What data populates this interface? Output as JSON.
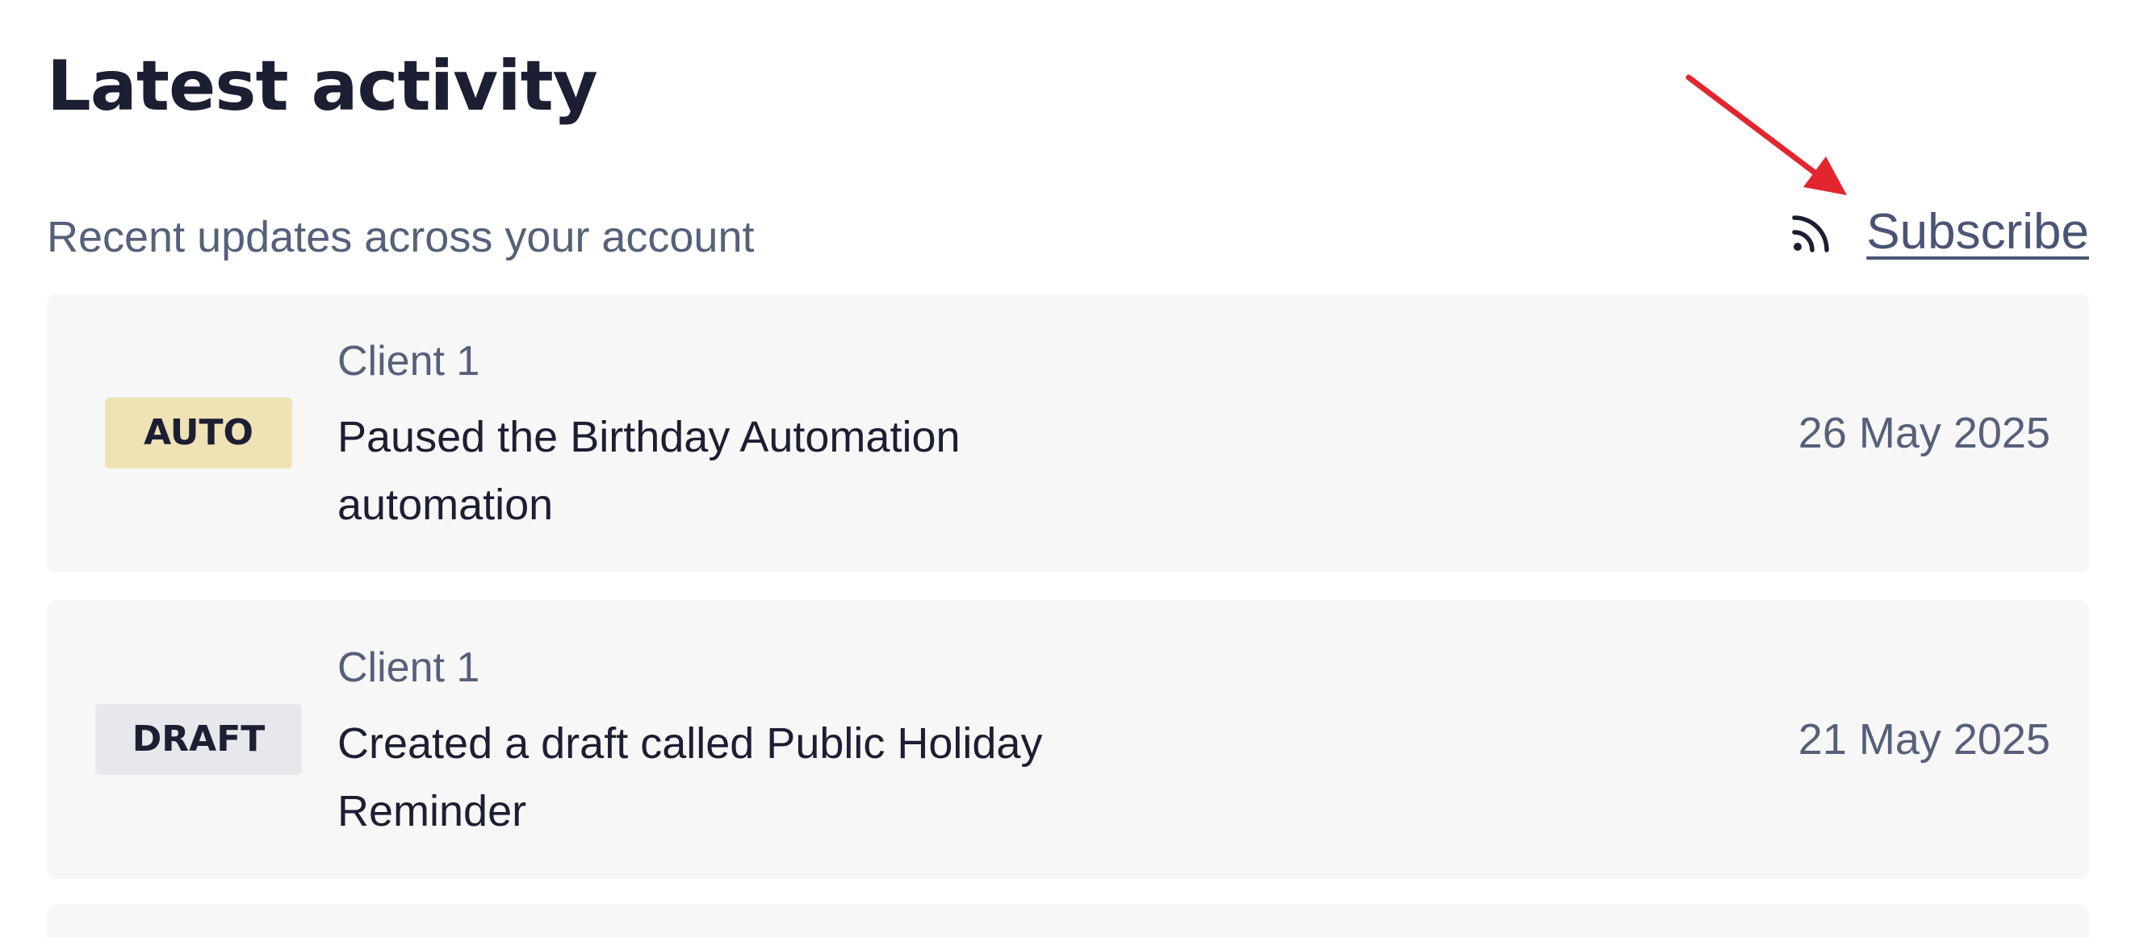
{
  "header": {
    "title": "Latest activity",
    "subtitle": "Recent updates across your account",
    "subscribe_label": "Subscribe",
    "subscribe_icon": "rss-icon"
  },
  "activities": [
    {
      "badge": "AUTO",
      "badge_color": "#efe2b4",
      "client": "Client 1",
      "text": "Paused the Birthday Automation automation",
      "date": "26 May 2025"
    },
    {
      "badge": "DRAFT",
      "badge_color": "#e7e8ec",
      "client": "Client 1",
      "text": "Created a draft called Public Holiday Reminder",
      "date": "21 May 2025"
    }
  ],
  "colors": {
    "title_text": "#1c1e33",
    "muted_text": "#55607a",
    "link_text": "#4a5575",
    "card_background": "#f7f7f8",
    "annotation_arrow": "#e3262e"
  }
}
